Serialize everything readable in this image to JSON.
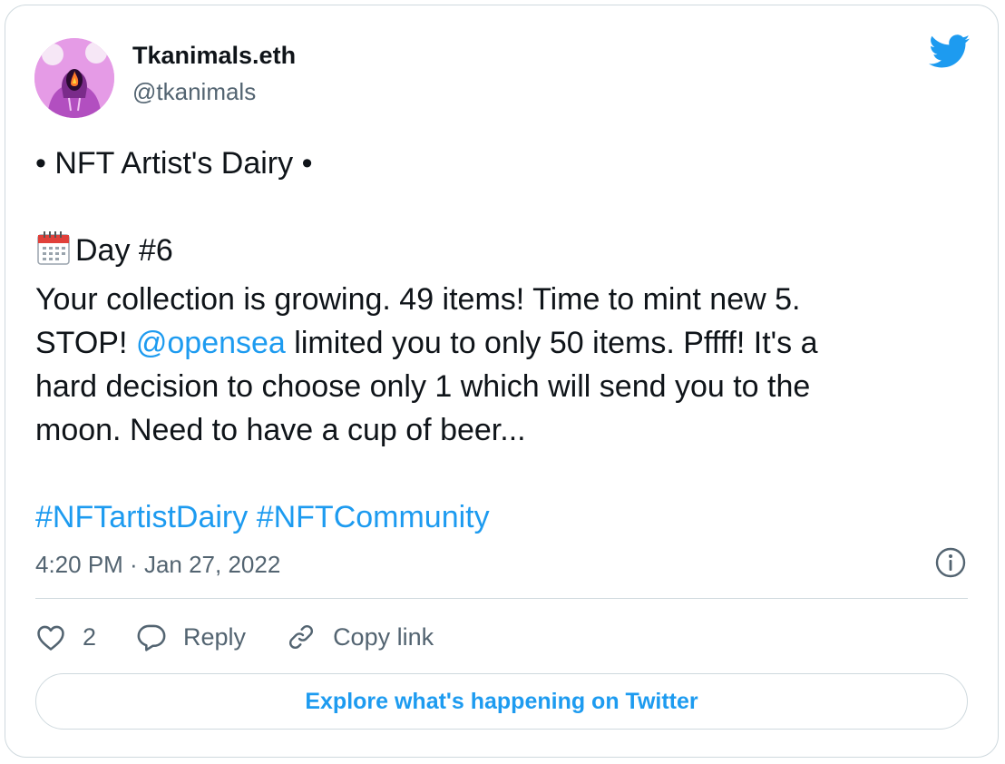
{
  "author": {
    "name": "Tkanimals.eth",
    "handle": "@tkanimals"
  },
  "tweet": {
    "line1": "• NFT Artist's Dairy •",
    "day_label": "Day #6",
    "para1": "Your collection is growing. 49 items! Time to mint new 5.",
    "stop": "STOP! ",
    "mention": "@opensea",
    "para2_rest": " limited you to only 50 items. Pffff! It's a",
    "para3": "hard decision to choose only 1 which will send you to the",
    "para4": "moon. Need to have a cup of beer...",
    "hashtag1": "#NFTartistDairy",
    "hashtag2": "#NFTCommunity"
  },
  "meta": {
    "time": "4:20 PM",
    "separator": " · ",
    "date": "Jan 27, 2022"
  },
  "actions": {
    "likes": "2",
    "reply": "Reply",
    "copy_link": "Copy link"
  },
  "explore_label": "Explore what's happening on Twitter",
  "colors": {
    "accent": "#1d9bf0",
    "secondary_text": "#536471",
    "border": "#cfd9de"
  },
  "icons": [
    "avatar-image",
    "twitter-bird-icon",
    "calendar-emoji-icon",
    "info-icon",
    "heart-icon",
    "reply-icon",
    "link-icon"
  ]
}
